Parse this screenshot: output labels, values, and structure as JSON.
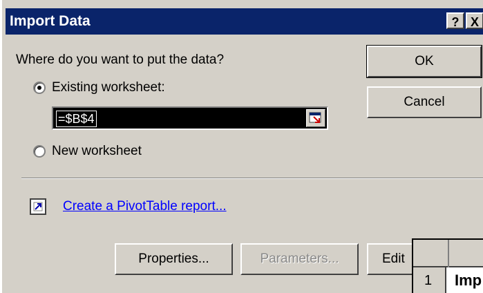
{
  "dialog": {
    "title": "Import Data",
    "help_label": "?",
    "close_label": "X",
    "question": "Where do you want to put the data?",
    "existing_label": "Existing worksheet:",
    "reference": "=$B$4",
    "new_label": "New worksheet",
    "pivot_link": "Create a PivotTable report...",
    "ok_label": "OK",
    "cancel_label": "Cancel",
    "properties_label": "Properties...",
    "parameters_label": "Parameters...",
    "edit_label": "Edit"
  },
  "sheet": {
    "row_number": "1",
    "cell_text": "Imp"
  },
  "colors": {
    "titlebar": "#0a246a",
    "face": "#d4d0c8",
    "link": "#0000ff"
  }
}
